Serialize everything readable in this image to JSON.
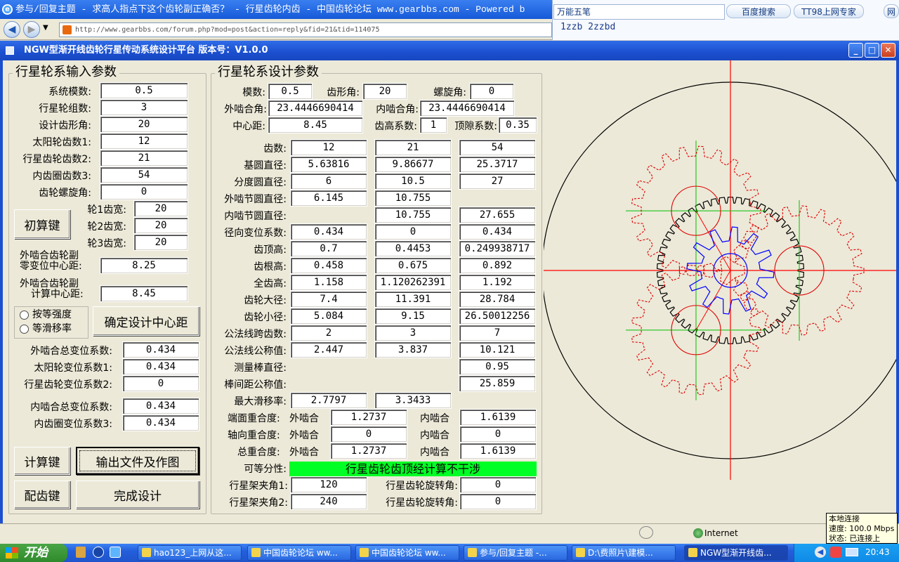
{
  "ie": {
    "title": "参与/回复主题 - 求高人指点下这个齿轮副正确否？ - 行星齿轮内齿 - 中国齿轮论坛 www.gearbbs.com - Powered b",
    "address": "http://www.gearbbs.com/forum.php?mod=post&action=reply&fid=21&tid=114075"
  },
  "ime": {
    "name": "万能五笔",
    "tab1": "百度搜索",
    "tab2": "TT98上网专家",
    "tab3": "网",
    "input": "1zzb 2zzbd"
  },
  "app": {
    "title": "NGW型渐开线齿轮行星传动系统设计平台  版本号：V1.0.0"
  },
  "input_group": {
    "title": "行星轮系输入参数",
    "rows": [
      {
        "label": "系统模数:",
        "value": "0.5"
      },
      {
        "label": "行星轮组数:",
        "value": "3"
      },
      {
        "label": "设计齿形角:",
        "value": "20"
      },
      {
        "label": "太阳轮齿数1:",
        "value": "12"
      },
      {
        "label": "行星齿轮齿数2:",
        "value": "21"
      },
      {
        "label": "内齿圈齿数3:",
        "value": "54"
      },
      {
        "label": "齿轮螺旋角:",
        "value": "0"
      }
    ],
    "chu_btn": "初算键",
    "widths": [
      {
        "label": "轮1齿宽:",
        "value": "20"
      },
      {
        "label": "轮2齿宽:",
        "value": "20"
      },
      {
        "label": "轮3齿宽:",
        "value": "20"
      }
    ],
    "zero_label1": "外啮合齿轮副",
    "zero_label2": "零变位中心距:",
    "zero_value": "8.25",
    "calc_label1": "外啮合齿轮副",
    "calc_label2": "计算中心距:",
    "calc_value": "8.45",
    "radio1": "按等强度",
    "radio2": "等滑移率",
    "confirm_btn": "确定设计中心距",
    "shift": [
      {
        "label": "外啮合总变位系数:",
        "value": "0.434"
      },
      {
        "label": "太阳轮变位系数1:",
        "value": "0.434"
      },
      {
        "label": "行星齿轮变位系数2:",
        "value": "0"
      }
    ],
    "inner_total_label": "内啮合总变位系数:",
    "inner_total": "0.434",
    "ring_shift_label": "内齿圈变位系数3:",
    "ring_shift": "0.434",
    "calc_btn": "计算键",
    "output_btn": "输出文件及作图",
    "match_btn": "配齿键",
    "finish_btn": "完成设计"
  },
  "design_group": {
    "title": "行星轮系设计参数",
    "module_label": "模数:",
    "module": "0.5",
    "profile_label": "齿形角:",
    "profile": "20",
    "helix_label": "螺旋角:",
    "helix": "0",
    "ext_angle_label": "外啮合角:",
    "ext_angle": "23.4446690414",
    "int_angle_label": "内啮合角:",
    "int_angle": "23.4446690414",
    "center_label": "中心距:",
    "center": "8.45",
    "addendum_coef_label": "齿高系数:",
    "addendum_coef": "1",
    "clearance_label": "顶隙系数:",
    "clearance": "0.35",
    "rows": [
      {
        "label": "齿数:",
        "v": [
          "12",
          "21",
          "54"
        ]
      },
      {
        "label": "基圆直径:",
        "v": [
          "5.63816",
          "9.86677",
          "25.3717"
        ]
      },
      {
        "label": "分度圆直径:",
        "v": [
          "6",
          "10.5",
          "27"
        ]
      },
      {
        "label": "外啮节圆直径:",
        "v": [
          "6.145",
          "10.755",
          ""
        ]
      },
      {
        "label": "内啮节圆直径:",
        "v": [
          "",
          "10.755",
          "27.655"
        ]
      },
      {
        "label": "径向变位系数:",
        "v": [
          "0.434",
          "0",
          "0.434"
        ]
      },
      {
        "label": "齿顶高:",
        "v": [
          "0.7",
          "0.4453",
          "0.249938717"
        ]
      },
      {
        "label": "齿根高:",
        "v": [
          "0.458",
          "0.675",
          "0.892"
        ]
      },
      {
        "label": "全齿高:",
        "v": [
          "1.158",
          "1.120262391",
          "1.192"
        ]
      },
      {
        "label": "齿轮大径:",
        "v": [
          "7.4",
          "11.391",
          "28.784"
        ]
      },
      {
        "label": "齿轮小径:",
        "v": [
          "5.084",
          "9.15",
          "26.50012256"
        ]
      },
      {
        "label": "公法线跨齿数:",
        "v": [
          "2",
          "3",
          "7"
        ]
      },
      {
        "label": "公法线公称值:",
        "v": [
          "2.447",
          "3.837",
          "10.121"
        ]
      },
      {
        "label": "测量棒直径:",
        "v": [
          "",
          "",
          "0.95"
        ]
      },
      {
        "label": "棒间距公称值:",
        "v": [
          "",
          "",
          "25.859"
        ]
      },
      {
        "label": "最大滑移率:",
        "v": [
          "2.7797",
          "3.3433",
          ""
        ]
      }
    ],
    "transverse_label": "端面重合度:",
    "axial_label": "轴向重合度:",
    "total_label": "总重合度:",
    "ext": "外啮合",
    "int": "内啮合",
    "transverse_ext": "1.2737",
    "transverse_int": "1.6139",
    "axial_ext": "0",
    "axial_int": "0",
    "total_ext": "1.2737",
    "total_int": "1.6139",
    "assembly_label": "可等分性:",
    "assembly_msg": "行星齿轮齿顶经计算不干涉",
    "carrier1_label": "行星架夹角1:",
    "carrier1": "120",
    "rot1_label": "行星齿轮旋转角:",
    "rot1": "0",
    "carrier2_label": "行星架夹角2:",
    "carrier2": "240",
    "rot2_label": "行星齿轮旋转角:",
    "rot2": "0"
  },
  "drawing": {
    "sun_teeth": 12,
    "planet_teeth": 21,
    "ring_teeth": 54,
    "planets": 3,
    "sun_color": "#0000ff",
    "planet_color": "#e00000",
    "axis_color": "#ff0000",
    "planet_axis_color": "#00c000",
    "ring_color": "#000000"
  },
  "status": {
    "zone": "Internet",
    "net_line1": "本地连接",
    "net_line2": "速度: 100.0 Mbps",
    "net_line3": "状态: 已连接上"
  },
  "taskbar": {
    "start": "开始",
    "items": [
      "hao123_上网从这...",
      "中国齿轮论坛 ww...",
      "中国齿轮论坛 ww...",
      "参与/回复主题 -...",
      "D:\\费照片\\建模...",
      "NGW型渐开线齿..."
    ],
    "clock": "20:43"
  }
}
